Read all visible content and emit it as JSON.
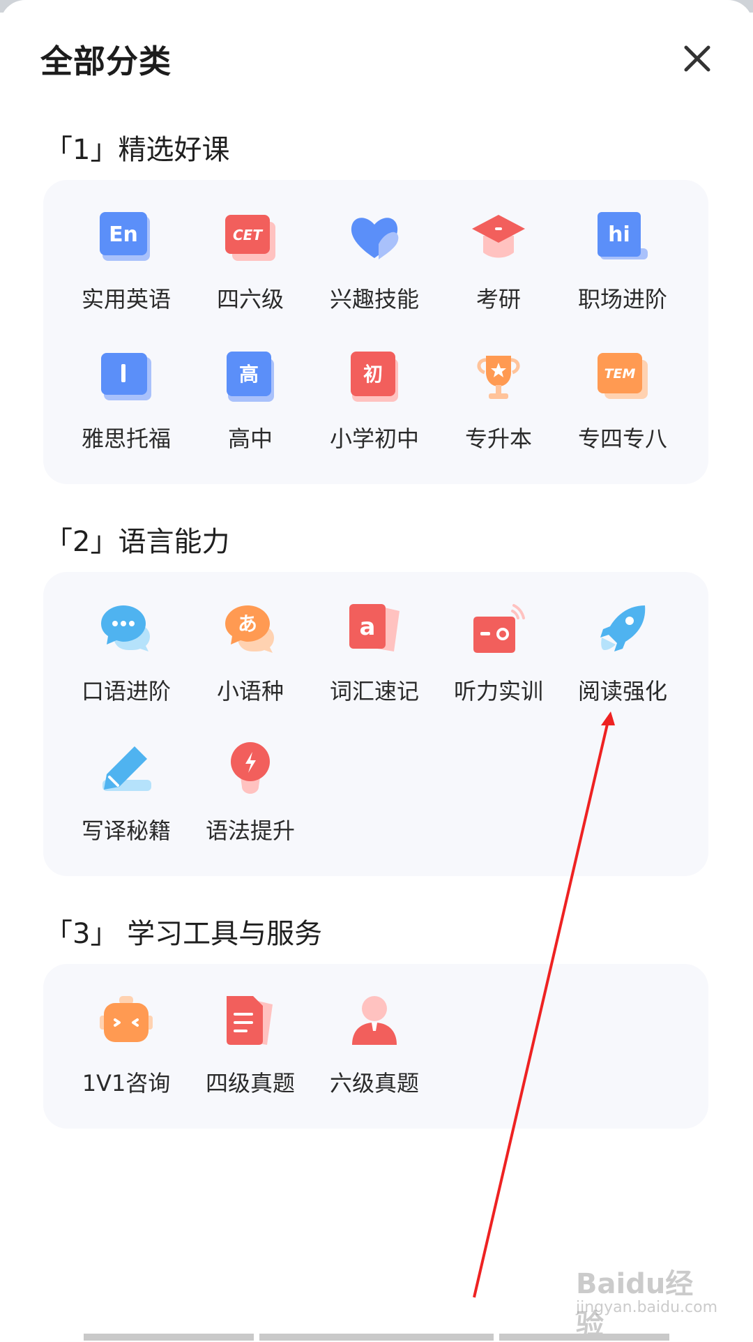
{
  "header": {
    "title": "全部分类",
    "close_icon": "close-icon"
  },
  "sections": [
    {
      "title": "「1」精选好课",
      "items": [
        {
          "label": "实用英语",
          "icon": "en-book-icon",
          "color": "#5b8ff9"
        },
        {
          "label": "四六级",
          "icon": "cet-icon",
          "color": "#f25f5c"
        },
        {
          "label": "兴趣技能",
          "icon": "heart-icon",
          "color": "#5b8ff9"
        },
        {
          "label": "考研",
          "icon": "graduation-cap-icon",
          "color": "#f25f5c"
        },
        {
          "label": "职场进阶",
          "icon": "hi-badge-icon",
          "color": "#5b8ff9"
        },
        {
          "label": "雅思托福",
          "icon": "book-icon",
          "color": "#5b8ff9"
        },
        {
          "label": "高中",
          "icon": "high-school-book-icon",
          "color": "#5b8ff9"
        },
        {
          "label": "小学初中",
          "icon": "primary-book-icon",
          "color": "#f25f5c"
        },
        {
          "label": "专升本",
          "icon": "trophy-icon",
          "color": "#ff9a52"
        },
        {
          "label": "专四专八",
          "icon": "tem-icon",
          "color": "#ff9a52"
        }
      ]
    },
    {
      "title": "「2」语言能力",
      "items": [
        {
          "label": "口语进阶",
          "icon": "chat-bubble-icon",
          "color": "#4fb3f0"
        },
        {
          "label": "小语种",
          "icon": "japanese-bubble-icon",
          "color": "#ff9a52"
        },
        {
          "label": "词汇速记",
          "icon": "letter-a-card-icon",
          "color": "#f25f5c"
        },
        {
          "label": "听力实训",
          "icon": "radio-icon",
          "color": "#f25f5c"
        },
        {
          "label": "阅读强化",
          "icon": "rocket-icon",
          "color": "#4fb3f0"
        },
        {
          "label": "写译秘籍",
          "icon": "pencil-icon",
          "color": "#4fb3f0"
        },
        {
          "label": "语法提升",
          "icon": "lightbulb-icon",
          "color": "#f25f5c"
        }
      ]
    },
    {
      "title": "「3」 学习工具与服务",
      "items": [
        {
          "label": "1V1咨询",
          "icon": "robot-icon",
          "color": "#ff9a52"
        },
        {
          "label": "四级真题",
          "icon": "document-icon",
          "color": "#f25f5c"
        },
        {
          "label": "六级真题",
          "icon": "person-icon",
          "color": "#f25f5c"
        }
      ]
    }
  ],
  "icon_glyphs": {
    "en": "En",
    "cet": "CET",
    "hi": "hi",
    "book_i": "I",
    "high": "高",
    "primary": "初",
    "tem": "TEM",
    "kana": "あ",
    "letter_a": "a"
  },
  "watermark": {
    "main": "Baidu经验",
    "sub": "jingyan.baidu.com"
  },
  "annotation": {
    "color": "#ee2222"
  }
}
